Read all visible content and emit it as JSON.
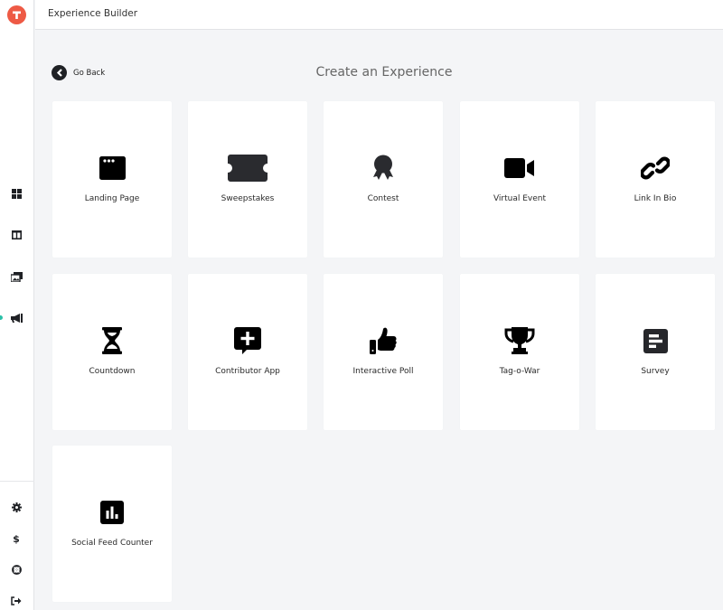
{
  "app": {
    "title": "Experience Builder",
    "brand_color": "#ee5a45",
    "accent_color": "#2bc0a8"
  },
  "sidebar": {
    "logo_icon": "t-logo-icon",
    "nav_items": [
      {
        "name": "dashboard",
        "icon": "grid-icon",
        "active": false
      },
      {
        "name": "layouts",
        "icon": "columns-icon",
        "active": false
      },
      {
        "name": "media",
        "icon": "images-icon",
        "active": false
      },
      {
        "name": "campaigns",
        "icon": "megaphone-icon",
        "active": true
      }
    ],
    "bottom_items": [
      {
        "name": "settings",
        "icon": "gear-icon"
      },
      {
        "name": "billing",
        "icon": "dollar-icon"
      },
      {
        "name": "help",
        "icon": "lifebuoy-icon"
      },
      {
        "name": "logout",
        "icon": "sign-out-icon"
      }
    ]
  },
  "header": {
    "go_back_label": "Go Back",
    "page_title": "Create an Experience"
  },
  "experiences": [
    {
      "label": "Landing Page",
      "icon": "browser-window-icon"
    },
    {
      "label": "Sweepstakes",
      "icon": "ticket-icon"
    },
    {
      "label": "Contest",
      "icon": "award-ribbon-icon"
    },
    {
      "label": "Virtual Event",
      "icon": "video-camera-icon"
    },
    {
      "label": "Link In Bio",
      "icon": "link-icon"
    },
    {
      "label": "Countdown",
      "icon": "hourglass-icon"
    },
    {
      "label": "Contributor App",
      "icon": "comment-plus-icon"
    },
    {
      "label": "Interactive Poll",
      "icon": "thumbs-up-icon"
    },
    {
      "label": "Tag-o-War",
      "icon": "trophy-icon"
    },
    {
      "label": "Survey",
      "icon": "survey-form-icon"
    },
    {
      "label": "Social Feed Counter",
      "icon": "bar-chart-icon"
    }
  ]
}
